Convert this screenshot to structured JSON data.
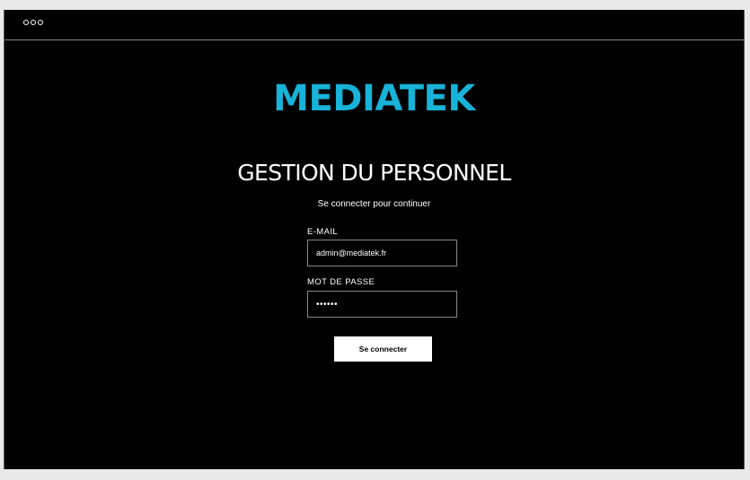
{
  "brand": "MEDIATEK",
  "heading": "GESTION DU PERSONNEL",
  "subheading": "Se connecter pour continuer",
  "form": {
    "email_label": "E-MAIL",
    "email_value": "admin@mediatek.fr",
    "password_label": "MOT DE PASSE",
    "password_value": "••••••",
    "submit_label": "Se connecter"
  },
  "colors": {
    "accent": "#17b3d8",
    "background": "#000000"
  }
}
